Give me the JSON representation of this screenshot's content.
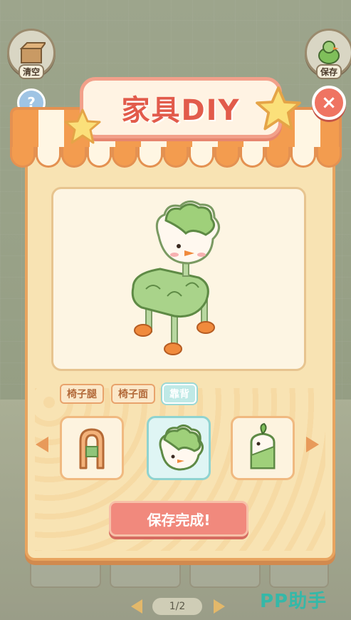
{
  "header": {
    "clear_label": "清空",
    "save_label": "保存",
    "help_symbol": "?"
  },
  "dialog": {
    "title": "家具DIY",
    "close_symbol": "×"
  },
  "tabs": [
    {
      "label": "椅子腿",
      "active": false
    },
    {
      "label": "椅子面",
      "active": false
    },
    {
      "label": "靠背",
      "active": true
    }
  ],
  "options": [
    {
      "icon": "wooden-arch-backrest-icon",
      "selected": false
    },
    {
      "icon": "leafy-sprout-backrest-icon",
      "selected": true
    },
    {
      "icon": "white-sprout-backrest-icon",
      "selected": false
    }
  ],
  "save_button": {
    "label": "保存完成!"
  },
  "pagination": {
    "text": "1/2"
  },
  "watermark": "PP助手",
  "colors": {
    "accent": "#e25b4b",
    "panel": "#f8e3b3",
    "active_tab": "#bfe9e6",
    "save_button": "#f1897d"
  }
}
